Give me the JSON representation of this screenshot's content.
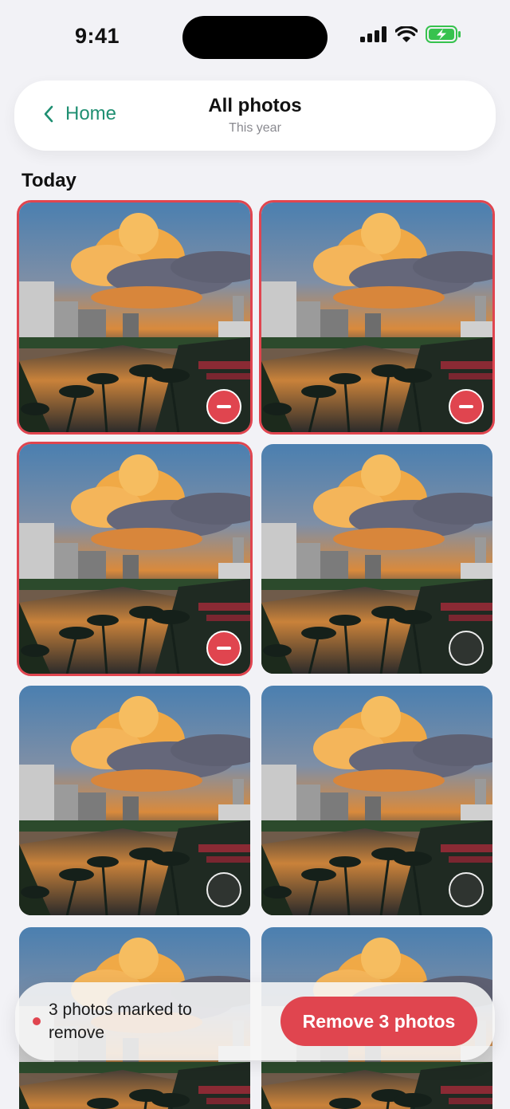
{
  "status_bar": {
    "time": "9:41"
  },
  "nav": {
    "back_label": "Home",
    "title": "All photos",
    "subtitle": "This year"
  },
  "section": {
    "title": "Today"
  },
  "photos": [
    {
      "marked": true
    },
    {
      "marked": true
    },
    {
      "marked": true
    },
    {
      "marked": false
    },
    {
      "marked": false
    },
    {
      "marked": false
    },
    {
      "marked": false
    },
    {
      "marked": false
    }
  ],
  "action_bar": {
    "status_text": "3 photos marked to remove",
    "button_label": "Remove 3 photos"
  },
  "colors": {
    "accent": "#1f8f72",
    "danger": "#e0454f",
    "background": "#f2f2f6"
  },
  "icons": [
    "signal-icon",
    "wifi-icon",
    "battery-charging-icon",
    "chevron-left-icon",
    "remove-badge-icon",
    "select-circle-icon"
  ]
}
